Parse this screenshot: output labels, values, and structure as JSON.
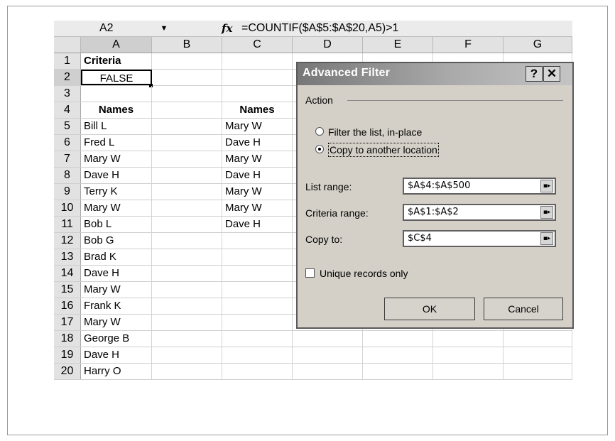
{
  "formula_bar": {
    "name_box": "A2",
    "name_box_arrow": "▼",
    "fx_label": "fx",
    "formula": "=COUNTIF($A$5:$A$20,A5)>1"
  },
  "columns": [
    "A",
    "B",
    "C",
    "D",
    "E",
    "F",
    "G"
  ],
  "rows": [
    {
      "num": "1",
      "a": "Criteria",
      "c": ""
    },
    {
      "num": "2",
      "a": "FALSE",
      "c": ""
    },
    {
      "num": "3",
      "a": "",
      "c": ""
    },
    {
      "num": "4",
      "a": "Names",
      "c": "Names"
    },
    {
      "num": "5",
      "a": "Bill L",
      "c": "Mary W"
    },
    {
      "num": "6",
      "a": "Fred L",
      "c": "Dave H"
    },
    {
      "num": "7",
      "a": "Mary W",
      "c": "Mary W"
    },
    {
      "num": "8",
      "a": "Dave H",
      "c": "Dave H"
    },
    {
      "num": "9",
      "a": "Terry K",
      "c": "Mary W"
    },
    {
      "num": "10",
      "a": "Mary W",
      "c": "Mary W"
    },
    {
      "num": "11",
      "a": "Bob L",
      "c": "Dave H"
    },
    {
      "num": "12",
      "a": "Bob G",
      "c": ""
    },
    {
      "num": "13",
      "a": "Brad K",
      "c": ""
    },
    {
      "num": "14",
      "a": "Dave H",
      "c": ""
    },
    {
      "num": "15",
      "a": "Mary W",
      "c": ""
    },
    {
      "num": "16",
      "a": "Frank K",
      "c": ""
    },
    {
      "num": "17",
      "a": "Mary W",
      "c": ""
    },
    {
      "num": "18",
      "a": "George B",
      "c": ""
    },
    {
      "num": "19",
      "a": "Dave H",
      "c": ""
    },
    {
      "num": "20",
      "a": "Harry O",
      "c": ""
    }
  ],
  "dialog": {
    "title": "Advanced Filter",
    "help_label": "?",
    "close_label": "✕",
    "action_group": "Action",
    "radio_filter": "Filter the list, in-place",
    "radio_copy": "Copy to another location",
    "list_range_label": "List range:",
    "list_range_value": "$A$4:$A$500",
    "criteria_range_label": "Criteria range:",
    "criteria_range_value": "$A$1:$A$2",
    "copy_to_label": "Copy to:",
    "copy_to_value": "$C$4",
    "unique_label": "Unique records only",
    "ok_label": "OK",
    "cancel_label": "Cancel",
    "selected_action": "copy",
    "unique_checked": false
  }
}
